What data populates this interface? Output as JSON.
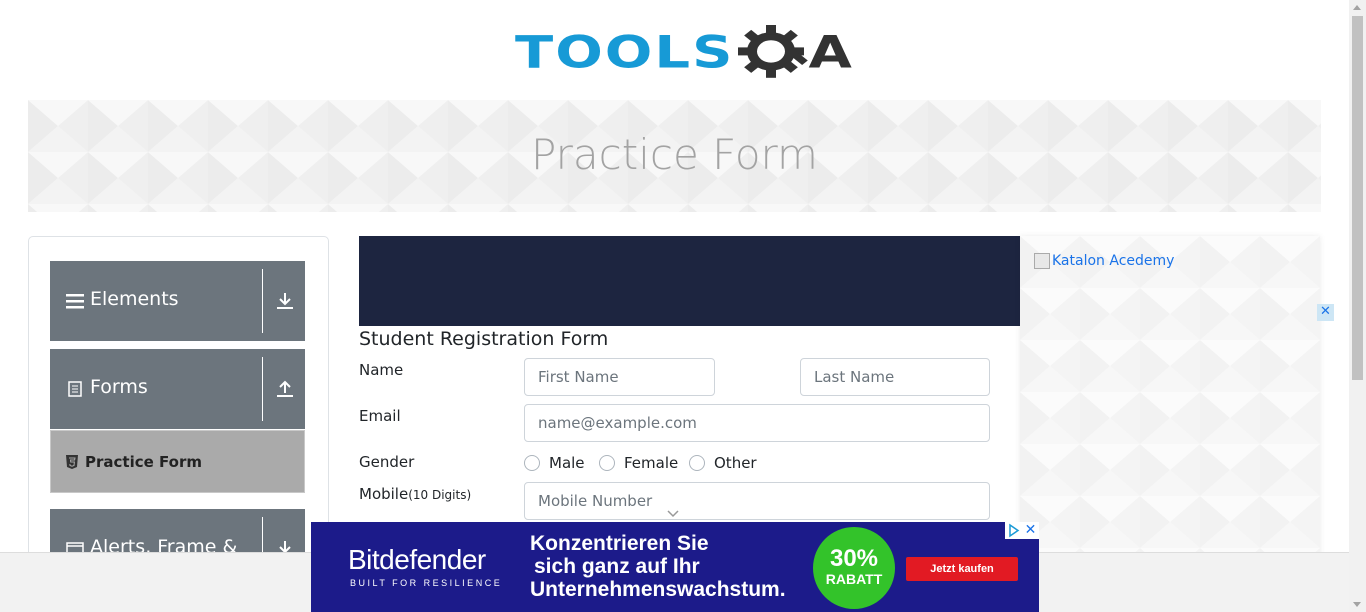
{
  "logo": {
    "tools": "TOOLS",
    "qa": "QA"
  },
  "banner": {
    "title": "Practice Form"
  },
  "sidebar": {
    "groups": [
      {
        "label": "Elements",
        "icon": "hamburger-icon",
        "arrow": "download-arrow-icon"
      },
      {
        "label": "Forms",
        "icon": "document-icon",
        "arrow": "upload-arrow-icon"
      },
      {
        "label": "Alerts, Frame &",
        "icon": "window-icon",
        "arrow": "download-arrow-icon"
      }
    ],
    "active_item": {
      "label": "Practice Form",
      "icon": "html5-icon"
    }
  },
  "form": {
    "title": "Student Registration Form",
    "name_label": "Name",
    "first_name_placeholder": "First Name",
    "last_name_placeholder": "Last Name",
    "email_label": "Email",
    "email_placeholder": "name@example.com",
    "gender_label": "Gender",
    "gender_options": [
      "Male",
      "Female",
      "Other"
    ],
    "mobile_label": "Mobile",
    "mobile_hint": "(10 Digits)",
    "mobile_placeholder": "Mobile Number"
  },
  "right_ad": {
    "alt_text": "Katalon Acedemy",
    "close": "✕"
  },
  "bottom_ad": {
    "brand": "Bitdefender",
    "tagline": "BUILT FOR RESILIENCE",
    "headline_1": "Konzentrieren Sie",
    "headline_2": "sich ganz auf Ihr",
    "headline_3": "Unternehmenswachstum.",
    "badge_pct": "30%",
    "badge_text": "RABATT",
    "cta": "Jetzt kaufen",
    "close": "✕"
  },
  "colors": {
    "brand_blue": "#179ad6",
    "nav_gray": "#6c757d",
    "form_header": "#1d2540",
    "ad_blue": "#1c1b8a",
    "ad_green": "#33c32a",
    "ad_red": "#e21a23"
  }
}
